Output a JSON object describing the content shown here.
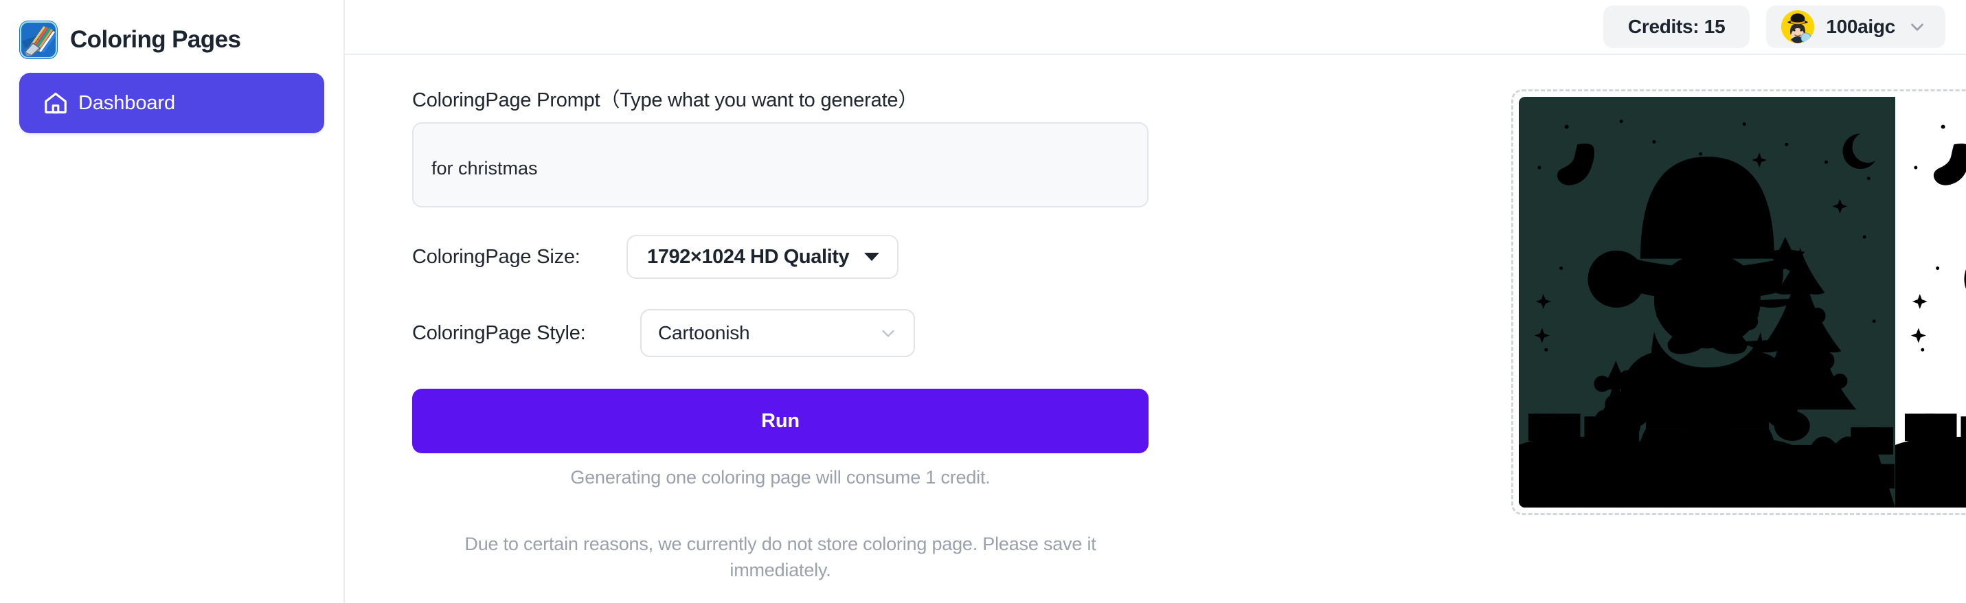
{
  "app": {
    "brand_title": "Coloring Pages",
    "brand_logo_icon": "colored-pencils-app-icon"
  },
  "sidebar": {
    "items": [
      {
        "label": "Dashboard",
        "icon": "home-icon",
        "active": true
      }
    ]
  },
  "topbar": {
    "credits_label": "Credits: 15",
    "user_name": "100aigc",
    "avatar_icon": "user-avatar",
    "caret_icon": "chevron-down-icon"
  },
  "form": {
    "prompt_label": "ColoringPage Prompt（Type what you want to generate）",
    "prompt_value": "for christmas",
    "prompt_placeholder": "Type what you want to generate",
    "size_label": "ColoringPage Size:",
    "size_value": "1792×1024 HD Quality",
    "size_options": [
      "1792×1024 HD Quality"
    ],
    "style_label": "ColoringPage Style:",
    "style_value": "Cartoonish",
    "style_options": [
      "Cartoonish"
    ],
    "run_label": "Run",
    "credit_hint": "Generating one coloring page will consume 1 credit.",
    "storage_notice": "Due to certain reasons, we currently do not store coloring page. Please save it immediately."
  },
  "preview": {
    "alt": "Generated christmas santa coloring page — colored version left, line-art version right"
  },
  "colors": {
    "accent_nav": "#4f46e5",
    "accent_run": "#5b13f0",
    "text_dark": "#1c2430",
    "muted": "#9aa1ab",
    "pill_bg": "#f2f3f5",
    "border": "#e3e5e8"
  }
}
